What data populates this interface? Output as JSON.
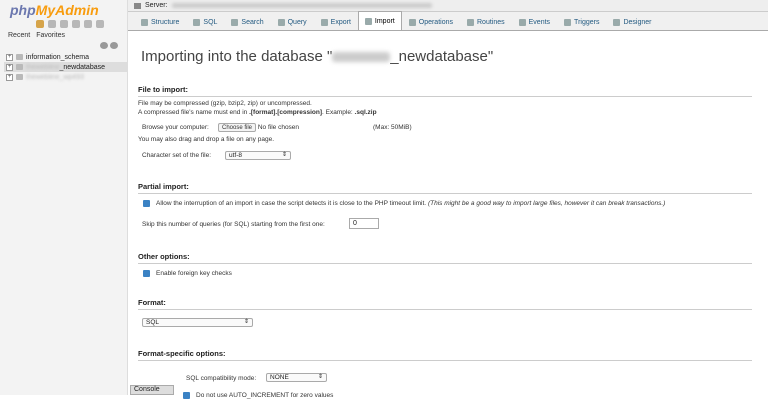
{
  "sidebar": {
    "logo_php": "php",
    "logo_myadmin": "MyAdmin",
    "tabs": [
      "Recent",
      "Favorites"
    ],
    "databases": [
      {
        "name": "information_schema",
        "blurred": false
      },
      {
        "name": "thewebline_newdatabase",
        "blurred": true,
        "visible_suffix": "_newdatabase",
        "active": true
      },
      {
        "name": "thewebline_wp493",
        "blurred": true
      }
    ]
  },
  "topbar": {
    "server_label": "Server:"
  },
  "tabs": [
    {
      "label": "Structure",
      "icon": "structure-icon"
    },
    {
      "label": "SQL",
      "icon": "sql-icon"
    },
    {
      "label": "Search",
      "icon": "search-icon"
    },
    {
      "label": "Query",
      "icon": "query-icon"
    },
    {
      "label": "Export",
      "icon": "export-icon"
    },
    {
      "label": "Import",
      "icon": "import-icon",
      "active": true
    },
    {
      "label": "Operations",
      "icon": "wrench-icon"
    },
    {
      "label": "Routines",
      "icon": "routines-icon"
    },
    {
      "label": "Events",
      "icon": "clock-icon"
    },
    {
      "label": "Triggers",
      "icon": "triggers-icon"
    },
    {
      "label": "Designer",
      "icon": "designer-icon"
    }
  ],
  "main": {
    "title_prefix": "Importing into the database \"",
    "title_suffix": "_newdatabase\"",
    "file_section": {
      "heading": "File to import:",
      "line1": "File may be compressed (gzip, bzip2, zip) or uncompressed.",
      "line2_prefix": "A compressed file's name must end in ",
      "line2_bold": ".[format].[compression]",
      "line2_mid": ". Example: ",
      "line2_example": ".sql.zip",
      "browse_label": "Browse your computer:",
      "choose_file_btn": "Choose file",
      "no_file": "No file chosen",
      "max_size": "(Max: 50MiB)",
      "drag_text": "You may also drag and drop a file on any page.",
      "charset_label": "Character set of the file:",
      "charset_value": "utf-8"
    },
    "partial_section": {
      "heading": "Partial import:",
      "allow_interrupt": "Allow the interruption of an import in case the script detects it is close to the PHP timeout limit.",
      "allow_interrupt_note": "(This might be a good way to import large files, however it can break transactions.)",
      "skip_label": "Skip this number of queries (for SQL) starting from the first one:",
      "skip_value": "0"
    },
    "other_section": {
      "heading": "Other options:",
      "foreign_keys": "Enable foreign key checks"
    },
    "format_section": {
      "heading": "Format:",
      "format_value": "SQL"
    },
    "format_specific_section": {
      "heading": "Format-specific options:",
      "compat_label": "SQL compatibility mode:",
      "compat_value": "NONE",
      "partial_option": "Do not use AUTO_INCREMENT for zero values"
    }
  },
  "console_label": "Console"
}
